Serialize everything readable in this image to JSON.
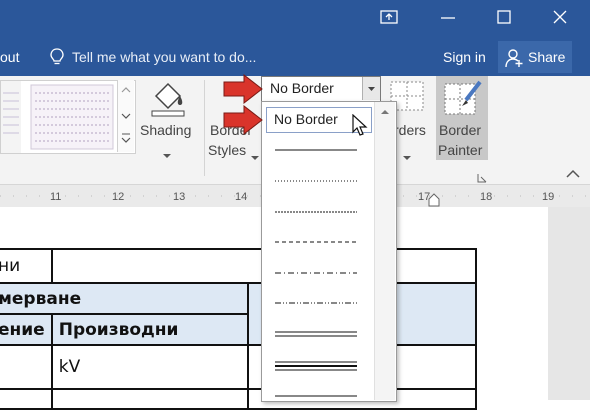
{
  "titlebar": {
    "tab_partial": "out",
    "tell_me_placeholder": "Tell me what you want to do...",
    "sign_in": "Sign in",
    "share": "Share"
  },
  "ribbon": {
    "shading": "Shading",
    "border_styles_line1": "Border",
    "border_styles_line2": "Styles",
    "borders_partial": "rders",
    "border_painter_line1": "Border",
    "border_painter_line2": "Painter"
  },
  "border_dropdown": {
    "selected": "No Border",
    "items": [
      {
        "label": "No Border",
        "style": "none"
      },
      {
        "label": "",
        "style": "solid"
      },
      {
        "label": "",
        "style": "dotted"
      },
      {
        "label": "",
        "style": "dotted-dense"
      },
      {
        "label": "",
        "style": "dashed"
      },
      {
        "label": "",
        "style": "dash-dot"
      },
      {
        "label": "",
        "style": "dash-dot-dot"
      },
      {
        "label": "",
        "style": "double"
      },
      {
        "label": "",
        "style": "thick-thin"
      }
    ]
  },
  "ruler": {
    "ticks": [
      "11",
      "12",
      "13",
      "14",
      "17",
      "18",
      "19"
    ]
  },
  "document": {
    "row1": "ни",
    "row2": "мерване",
    "row3_col1": "ение",
    "row3_col2": "Производни",
    "row4_col2": "kV"
  },
  "colors": {
    "titlebar": "#2b579a",
    "callout_arrow": "#d9342b",
    "table_shade": "#dde8f4"
  }
}
